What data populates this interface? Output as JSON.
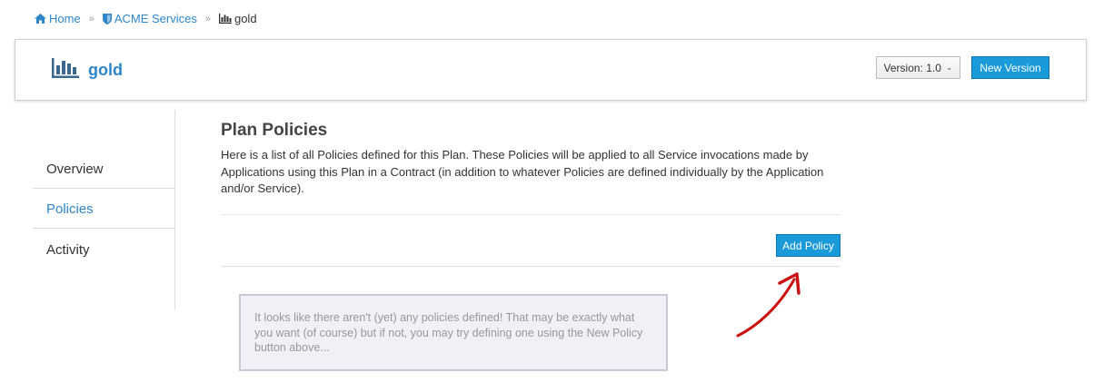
{
  "breadcrumb": {
    "home": "Home",
    "service": "ACME Services",
    "current": "gold"
  },
  "header": {
    "title": "gold",
    "version_label": "Version: 1.0",
    "new_version_label": "New Version"
  },
  "sidebar": {
    "items": [
      {
        "label": "Overview",
        "active": false
      },
      {
        "label": "Policies",
        "active": true
      },
      {
        "label": "Activity",
        "active": false
      }
    ]
  },
  "main": {
    "title": "Plan Policies",
    "description": "Here is a list of all Policies defined for this Plan. These Policies will be applied to all Service invocations made by Applications using this Plan in a Contract (in addition to whatever Policies are defined individually by the Application and/or Service).",
    "add_policy_label": "Add Policy",
    "empty_message": "It looks like there aren't (yet) any policies defined! That may be exactly what you want (of course) but if not, you may try defining one using the New Policy button above..."
  },
  "colors": {
    "accent": "#2e86c8",
    "button": "#1a9ad8",
    "arrow": "#cc1111"
  }
}
